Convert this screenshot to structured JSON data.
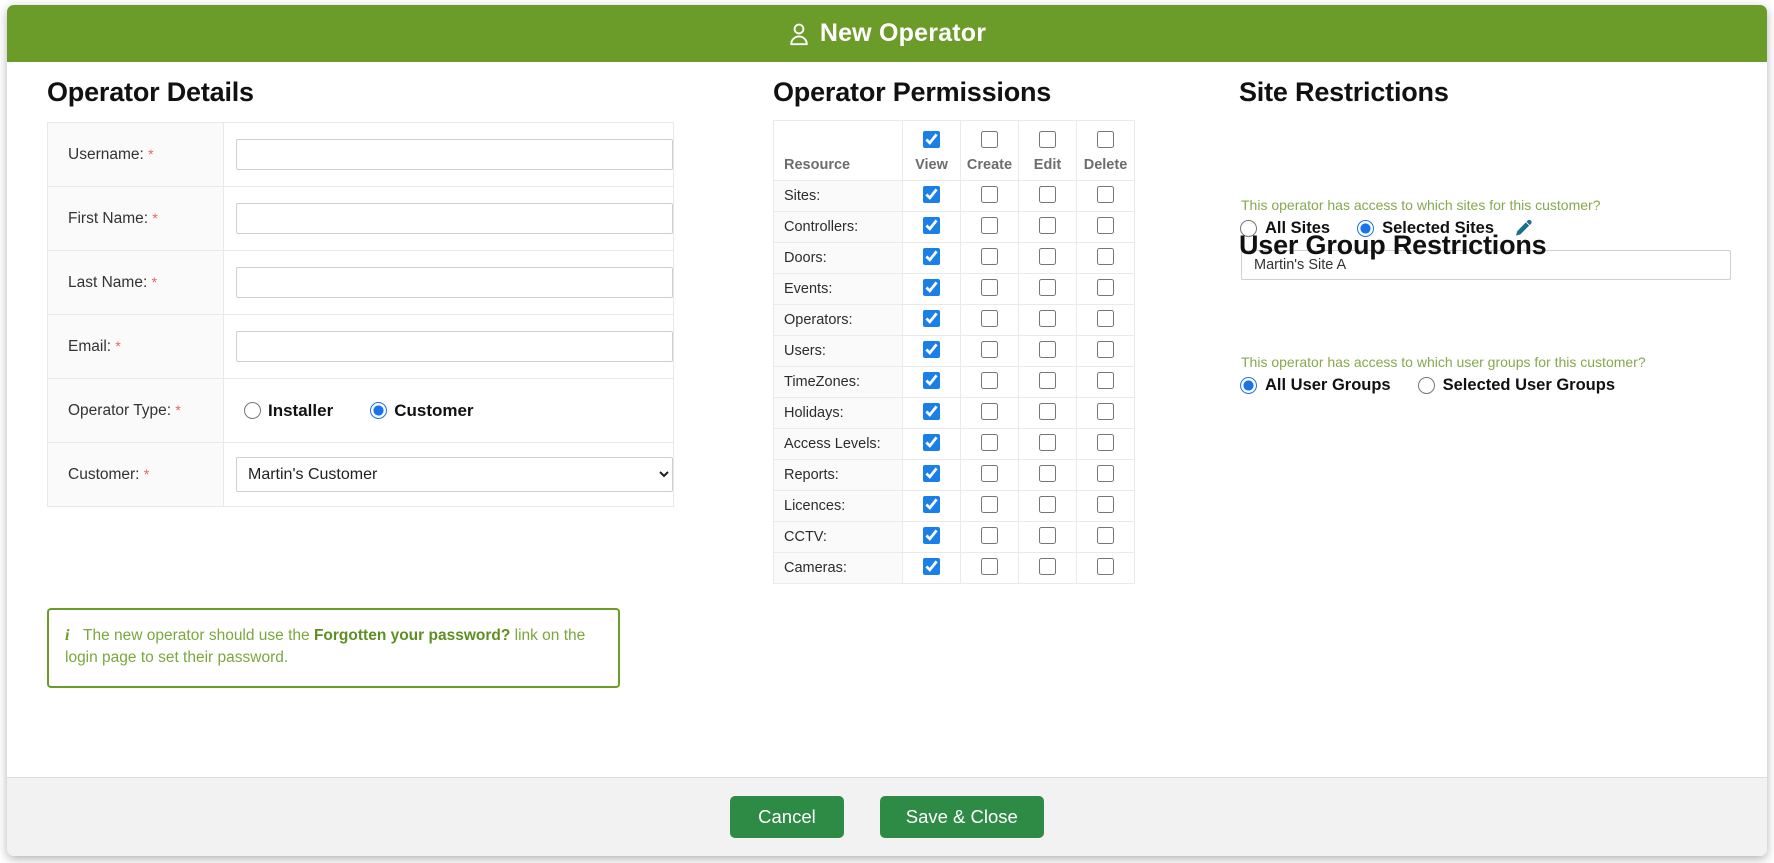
{
  "window": {
    "title": "New Operator",
    "title_icon": "user-icon",
    "header_color": "#6b9b28"
  },
  "details": {
    "heading": "Operator Details",
    "required_marker": "*",
    "fields": [
      {
        "label": "Username:",
        "required": true,
        "type": "text",
        "value": "",
        "placeholder": ""
      },
      {
        "label": "First Name:",
        "required": true,
        "type": "text",
        "value": "",
        "placeholder": ""
      },
      {
        "label": "Last Name:",
        "required": true,
        "type": "text",
        "value": "",
        "placeholder": ""
      },
      {
        "label": "Email:",
        "required": true,
        "type": "text",
        "value": "",
        "placeholder": ""
      },
      {
        "label": "Operator Type:",
        "required": true,
        "type": "radio",
        "value": "Customer"
      },
      {
        "label": "Customer:",
        "required": true,
        "type": "select",
        "value": "Martin's Customer"
      }
    ],
    "operator_type": {
      "options": [
        "Installer",
        "Customer"
      ],
      "selected": "Customer"
    },
    "customer_select": {
      "selected": "Martin's Customer",
      "options": [
        "Martin's Customer"
      ]
    }
  },
  "callout": {
    "icon": "info-icon",
    "text_before": "The new operator should use the ",
    "bold_text": "Forgotten your password?",
    "text_after": " link on the login page to set their password.",
    "border_color": "#6b9b28",
    "text_color": "#7aa83c"
  },
  "permissions": {
    "heading": "Operator Permissions",
    "columns": [
      "Resource",
      "View",
      "Create",
      "Edit",
      "Delete"
    ],
    "header_checkboxes": {
      "View": true,
      "Create": false,
      "Edit": false,
      "Delete": false
    },
    "rows": [
      {
        "resource": "Sites:",
        "view": true,
        "create": false,
        "edit": false,
        "delete": false
      },
      {
        "resource": "Controllers:",
        "view": true,
        "create": false,
        "edit": false,
        "delete": false
      },
      {
        "resource": "Doors:",
        "view": true,
        "create": false,
        "edit": false,
        "delete": false
      },
      {
        "resource": "Events:",
        "view": true,
        "create": false,
        "edit": false,
        "delete": false
      },
      {
        "resource": "Operators:",
        "view": true,
        "create": false,
        "edit": false,
        "delete": false
      },
      {
        "resource": "Users:",
        "view": true,
        "create": false,
        "edit": false,
        "delete": false
      },
      {
        "resource": "TimeZones:",
        "view": true,
        "create": false,
        "edit": false,
        "delete": false
      },
      {
        "resource": "Holidays:",
        "view": true,
        "create": false,
        "edit": false,
        "delete": false
      },
      {
        "resource": "Access Levels:",
        "view": true,
        "create": false,
        "edit": false,
        "delete": false
      },
      {
        "resource": "Reports:",
        "view": true,
        "create": false,
        "edit": false,
        "delete": false
      },
      {
        "resource": "Licences:",
        "view": true,
        "create": false,
        "edit": false,
        "delete": false
      },
      {
        "resource": "CCTV:",
        "view": true,
        "create": false,
        "edit": false,
        "delete": false
      },
      {
        "resource": "Cameras:",
        "view": true,
        "create": false,
        "edit": false,
        "delete": false
      }
    ]
  },
  "site_restrictions": {
    "heading": "Site Restrictions",
    "hint": "This operator has access to which sites for this customer?",
    "options": [
      "All Sites",
      "Selected Sites"
    ],
    "selected": "Selected Sites",
    "edit_icon": "pencil-icon",
    "selected_sites": [
      "Martin's Site A"
    ]
  },
  "user_group_restrictions": {
    "heading": "User Group Restrictions",
    "hint": "This operator has access to which user groups for this customer?",
    "options": [
      "All User Groups",
      "Selected User Groups"
    ],
    "selected": "All User Groups"
  },
  "footer": {
    "cancel_label": "Cancel",
    "save_label": "Save & Close",
    "button_color": "#2e8b45"
  }
}
